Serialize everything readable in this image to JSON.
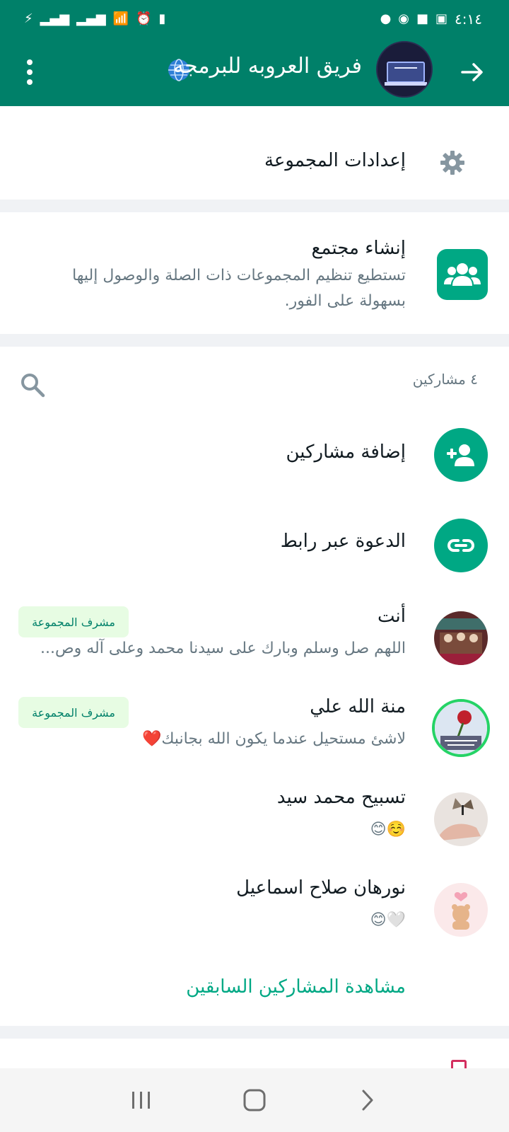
{
  "status_bar": {
    "time": "٤:١٤"
  },
  "header": {
    "title": "فريق العروبه للبرمجه",
    "title_emoji": "🌐"
  },
  "settings": {
    "label": "إعدادات المجموعة"
  },
  "community": {
    "title": "إنشاء مجتمع",
    "description": "تستطيع تنظيم المجموعات ذات الصلة والوصول إليها بسهولة على الفور."
  },
  "participants": {
    "count_label": "٤ مشاركين",
    "add_label": "إضافة مشاركين",
    "invite_label": "الدعوة عبر رابط",
    "members": [
      {
        "name": "أنت",
        "status": "اللهم صل وسلم وبارك على سيدنا محمد وعلى آله وص...",
        "badge": "مشرف المجموعة"
      },
      {
        "name": "منة الله علي",
        "status": "لاشئ مستحيل عندما يكون الله بجانبك❤️",
        "badge": "مشرف المجموعة"
      },
      {
        "name": "تسبيح محمد سيد",
        "status": "☺️😊"
      },
      {
        "name": "نورهان صلاح اسماعيل",
        "status": "🤍😊"
      }
    ],
    "past_link": "مشاهدة المشاركين السابقين"
  },
  "colors": {
    "primary": "#008069",
    "accent": "#00a884",
    "badge_bg": "#e7fce3",
    "secondary_text": "#667781"
  },
  "icons": [
    "back-arrow-icon",
    "gear-icon",
    "community-icon",
    "search-icon",
    "add-person-icon",
    "link-icon",
    "menu-icon",
    "globe-icon"
  ]
}
